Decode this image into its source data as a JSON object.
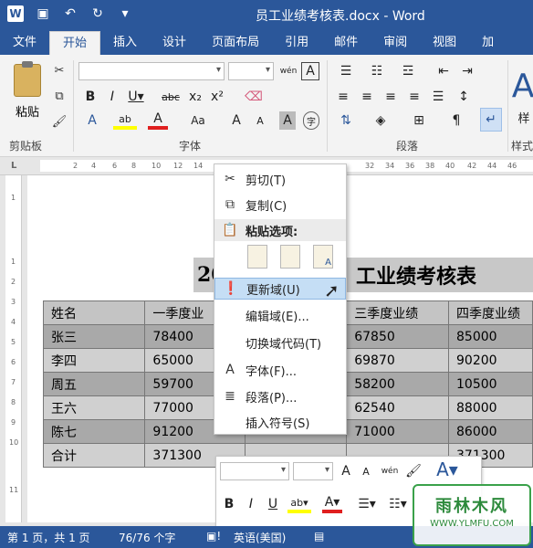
{
  "window": {
    "title": "员工业绩考核表.docx - Word",
    "app_icon": "W"
  },
  "qat": {
    "save": "save-icon",
    "undo": "undo-icon",
    "redo": "redo-icon",
    "customize": "customize-qat-icon"
  },
  "tabs": [
    {
      "label": "文件"
    },
    {
      "label": "开始"
    },
    {
      "label": "插入"
    },
    {
      "label": "设计"
    },
    {
      "label": "页面布局"
    },
    {
      "label": "引用"
    },
    {
      "label": "邮件"
    },
    {
      "label": "审阅"
    },
    {
      "label": "视图"
    },
    {
      "label": "加"
    }
  ],
  "active_tab": "开始",
  "ribbon": {
    "paste_label": "粘贴",
    "groups": {
      "clipboard": "剪贴板",
      "font": "字体",
      "paragraph": "段落",
      "styles": "样式"
    },
    "style_letter": "A",
    "style_text": "样"
  },
  "document": {
    "heading_visible_left": "20",
    "heading_visible_right": "工业绩考核表",
    "table": [
      [
        "姓名",
        "一季度业",
        "",
        "三季度业绩",
        "四季度业绩"
      ],
      [
        "张三",
        "78400",
        "",
        "67850",
        "85000"
      ],
      [
        "李四",
        "65000",
        "",
        "69870",
        "90200"
      ],
      [
        "周五",
        "59700",
        "",
        "58200",
        "10500"
      ],
      [
        "王六",
        "77000",
        "",
        "62540",
        "88000"
      ],
      [
        "陈七",
        "91200",
        "",
        "71000",
        "86000"
      ],
      [
        "合计",
        "371300",
        "",
        "",
        "371300"
      ]
    ]
  },
  "context_menu": {
    "items": [
      {
        "icon": "scissors-icon",
        "label": "剪切(T)"
      },
      {
        "icon": "copy-icon",
        "label": "复制(C)"
      },
      {
        "icon": "clipboard-icon",
        "label": "粘贴选项:"
      },
      {
        "icon": "update-field-icon",
        "label": "更新域(U)"
      },
      {
        "icon": "",
        "label": "编辑域(E)..."
      },
      {
        "icon": "",
        "label": "切换域代码(T)"
      },
      {
        "icon": "font-icon",
        "label": "字体(F)..."
      },
      {
        "icon": "paragraph-icon",
        "label": "段落(P)..."
      },
      {
        "icon": "",
        "label": "插入符号(S)"
      }
    ],
    "paste_option_letters": [
      "",
      "",
      "A"
    ]
  },
  "mini_toolbar": {
    "font_size_icon": "A",
    "wen_label": "wén 文"
  },
  "statusbar": {
    "page": "第 1 页，共 1 页",
    "words": "76/76 个字",
    "language": "英语(美国)"
  },
  "watermark": {
    "line1": "雨林木风",
    "line2": "WWW.YLMFU.COM"
  }
}
